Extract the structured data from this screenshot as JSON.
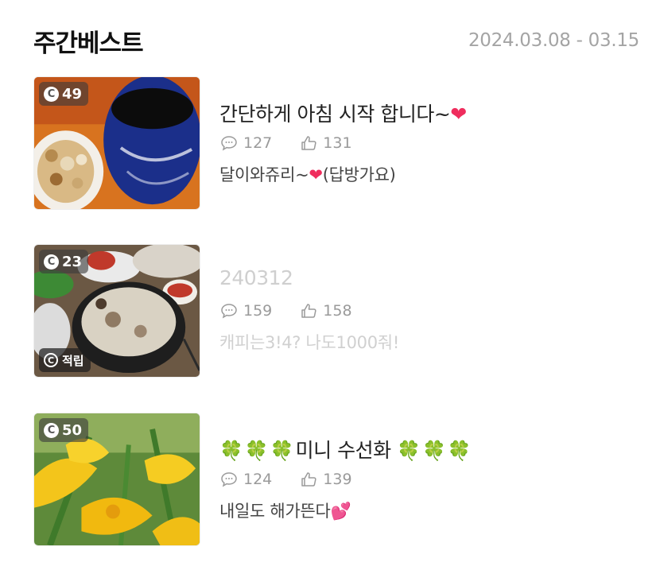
{
  "header": {
    "title": "주간베스트",
    "date_range": "2024.03.08 - 03.15"
  },
  "posts": [
    {
      "coins": "49",
      "title": "간단하게 아침 시작 합니다~",
      "title_emoji": "❤",
      "comments": "127",
      "likes": "131",
      "preview": "달이와쥬리~",
      "preview_emoji": "❤",
      "preview_tail": "(답방가요)"
    },
    {
      "coins": "23",
      "accum_label": "적립",
      "accum_icon": "c-icon",
      "title": "240312",
      "comments": "159",
      "likes": "158",
      "preview": "캐피는3!4? 나도1000줘!"
    },
    {
      "coins": "50",
      "title_prefix": "🍀🍀🍀",
      "title": "미니 수선화 ",
      "title_suffix": "🍀🍀🍀",
      "comments": "124",
      "likes": "139",
      "preview": "내일도 해가뜬다",
      "preview_emoji": "💕"
    }
  ],
  "icons": {
    "comment": "comment-bubble-icon",
    "like": "thumbs-up-icon",
    "coin": "coin-c-icon"
  },
  "colors": {
    "muted": "#9a9a9a",
    "date": "#a4a4a4",
    "heart": "#ef2d5d",
    "clover": "#37a64c"
  }
}
